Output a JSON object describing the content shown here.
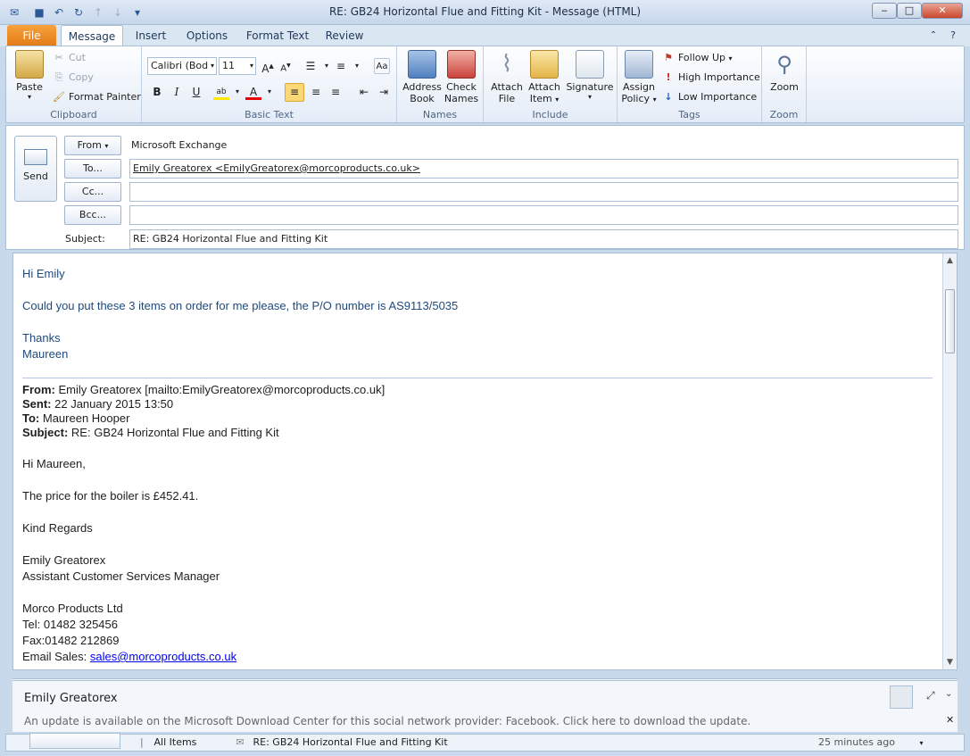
{
  "window": {
    "title": "RE: GB24 Horizontal Flue and Fitting Kit  -  Message (HTML)"
  },
  "colors": {
    "accent_file": "#e27a15",
    "ribbon_bg": "#e4ecf7",
    "body_blue_text": "#1f497d",
    "link": "#0000ee"
  },
  "tabs": [
    "File",
    "Message",
    "Insert",
    "Options",
    "Format Text",
    "Review"
  ],
  "ribbon": {
    "clipboard": {
      "paste": "Paste",
      "cut": "Cut",
      "copy": "Copy",
      "format_painter": "Format Painter",
      "label": "Clipboard"
    },
    "basic_text": {
      "font": "Calibri (Bod",
      "size": "11",
      "label": "Basic Text"
    },
    "names": {
      "address_book_1": "Address",
      "address_book_2": "Book",
      "check_names_1": "Check",
      "check_names_2": "Names",
      "label": "Names"
    },
    "include": {
      "attach_file_1": "Attach",
      "attach_file_2": "File",
      "attach_item_1": "Attach",
      "attach_item_2": "Item",
      "signature": "Signature",
      "label": "Include"
    },
    "tags": {
      "assign_policy_1": "Assign",
      "assign_policy_2": "Policy",
      "follow_up": "Follow Up",
      "high_importance": "High Importance",
      "low_importance": "Low Importance",
      "label": "Tags"
    },
    "zoom": {
      "zoom": "Zoom",
      "label": "Zoom"
    }
  },
  "compose": {
    "send": "Send",
    "from_label": "From",
    "from_value": "Microsoft Exchange",
    "to_label": "To...",
    "to_value": "Emily Greatorex <EmilyGreatorex@morcoproducts.co.uk>",
    "cc_label": "Cc...",
    "cc_value": "",
    "bcc_label": "Bcc...",
    "bcc_value": "",
    "subject_label": "Subject:",
    "subject_value": "RE: GB24 Horizontal Flue and Fitting Kit"
  },
  "message": {
    "greeting": "Hi Emily",
    "line1": "Could you put these 3 items on order for me please, the P/O number is AS9113/5035",
    "thanks": "Thanks",
    "name": "Maureen",
    "from_label": "From:",
    "from_value": "Emily Greatorex [mailto:EmilyGreatorex@morcoproducts.co.uk]",
    "sent_label": "Sent:",
    "sent_value": "22 January 2015 13:50",
    "to_label": "To:",
    "to_value": "Maureen Hooper",
    "subject_label": "Subject:",
    "subject_value": "RE: GB24 Horizontal Flue and Fitting Kit",
    "reply_greeting": "Hi Maureen,",
    "price_line": "The price for the boiler is £452.41.",
    "regards": "Kind Regards",
    "sig_name": "Emily Greatorex",
    "sig_title": "Assistant Customer Services Manager",
    "company": "Morco Products Ltd",
    "tel": "Tel: 01482 325456",
    "fax": "Fax:01482 212869",
    "email_label": "Email Sales:",
    "email_link": "sales@morcoproducts.co.uk"
  },
  "people_pane": {
    "name": "Emily Greatorex",
    "notice": "An update is available on the Microsoft Download Center for this social network provider: Facebook. Click here to download the update."
  },
  "status": {
    "all_items": "All Items",
    "item_subject": "RE: GB24 Horizontal Flue and Fitting Kit",
    "time": "25 minutes ago"
  }
}
